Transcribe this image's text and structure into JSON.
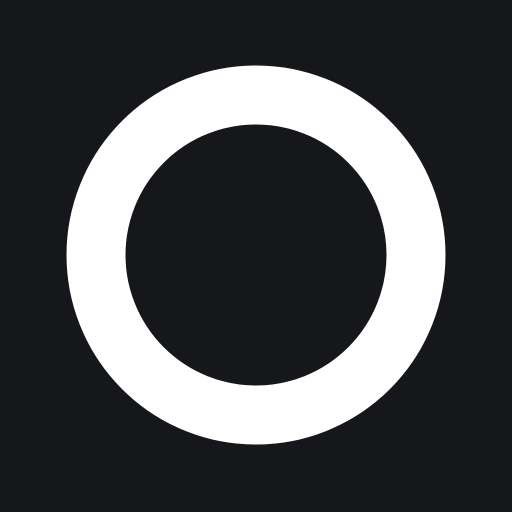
{
  "colors": {
    "background": "#16171b",
    "ring": "#ffffff"
  },
  "icon": {
    "name": "ring-icon"
  }
}
